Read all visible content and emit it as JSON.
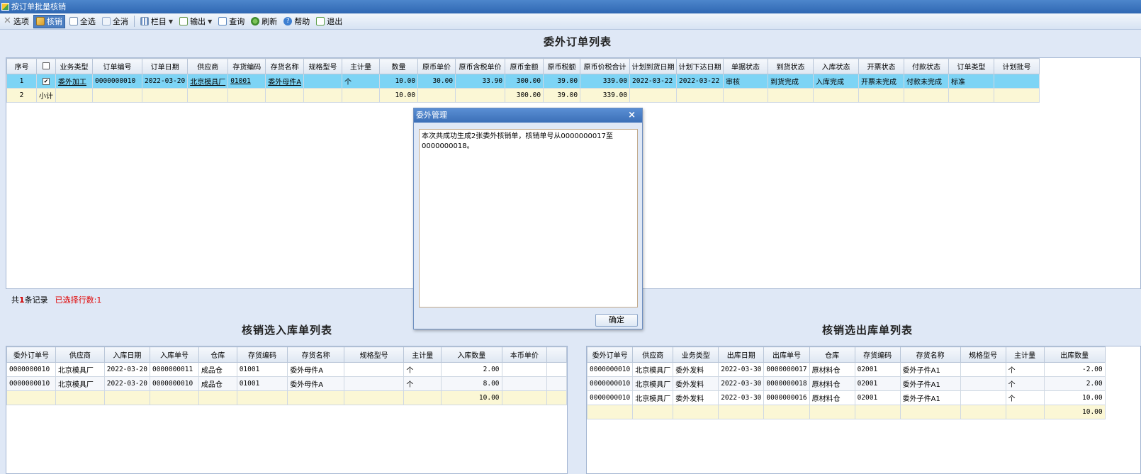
{
  "window": {
    "title": "按订单批量核销"
  },
  "toolbar": {
    "options": "选项",
    "writeoff": "核销",
    "select_all": "全选",
    "deselect_all": "全消",
    "columns": "栏目",
    "export": "输出",
    "query": "查询",
    "refresh": "刷新",
    "help": "帮助",
    "exit": "退出"
  },
  "orders": {
    "title": "委外订单列表",
    "headers": [
      "序号",
      "",
      "业务类型",
      "订单编号",
      "订单日期",
      "供应商",
      "存货编码",
      "存货名称",
      "规格型号",
      "主计量",
      "数量",
      "原币单价",
      "原币含税单价",
      "原币金额",
      "原币税额",
      "原币价税合计",
      "计划到货日期",
      "计划下达日期",
      "单据状态",
      "到货状态",
      "入库状态",
      "开票状态",
      "付款状态",
      "订单类型",
      "计划批号"
    ],
    "rows": [
      {
        "no": "1",
        "checked": "✔",
        "biz_type": "委外加工",
        "order_no": "0000000010",
        "order_date": "2022-03-20",
        "supplier": "北京模具厂",
        "inv_code": "01001",
        "inv_name": "委外母件A",
        "spec": "",
        "unit": "个",
        "qty": "10.00",
        "price": "30.00",
        "tax_price": "33.90",
        "amount": "300.00",
        "tax": "39.00",
        "total": "339.00",
        "plan_arrive": "2022-03-22",
        "plan_issue": "2022-03-22",
        "doc_status": "审核",
        "arrive_status": "到货完成",
        "instock_status": "入库完成",
        "invoice_status": "开票未完成",
        "pay_status": "付款未完成",
        "order_type": "标准",
        "batch": ""
      },
      {
        "no": "2",
        "label": "小计",
        "qty": "10.00",
        "amount": "300.00",
        "tax": "39.00",
        "total": "339.00"
      }
    ],
    "status_prefix": "共",
    "count": "1",
    "status_suffix": "条记录",
    "selected": "已选择行数:1"
  },
  "instock": {
    "title": "核销选入库单列表",
    "headers": [
      "委外订单号",
      "供应商",
      "入库日期",
      "入库单号",
      "仓库",
      "存货编码",
      "存货名称",
      "规格型号",
      "主计量",
      "入库数量",
      "本币单价",
      ""
    ],
    "rows": [
      [
        "0000000010",
        "北京模具厂",
        "2022-03-20",
        "0000000011",
        "成品仓",
        "01001",
        "委外母件A",
        "",
        "个",
        "2.00",
        ""
      ],
      [
        "0000000010",
        "北京模具厂",
        "2022-03-20",
        "0000000010",
        "成品仓",
        "01001",
        "委外母件A",
        "",
        "个",
        "8.00",
        ""
      ],
      [
        "",
        "",
        "",
        "",
        "",
        "",
        "",
        "",
        "",
        "10.00",
        ""
      ]
    ]
  },
  "outstock": {
    "title": "核销选出库单列表",
    "headers": [
      "委外订单号",
      "供应商",
      "业务类型",
      "出库日期",
      "出库单号",
      "仓库",
      "存货编码",
      "存货名称",
      "规格型号",
      "主计量",
      "出库数量"
    ],
    "rows": [
      [
        "0000000010",
        "北京模具厂",
        "委外发料",
        "2022-03-30",
        "0000000017",
        "原材料仓",
        "02001",
        "委外子件A1",
        "",
        "个",
        "-2.00"
      ],
      [
        "0000000010",
        "北京模具厂",
        "委外发料",
        "2022-03-30",
        "0000000018",
        "原材料仓",
        "02001",
        "委外子件A1",
        "",
        "个",
        "2.00"
      ],
      [
        "0000000010",
        "北京模具厂",
        "委外发料",
        "2022-03-30",
        "0000000016",
        "原材料仓",
        "02001",
        "委外子件A1",
        "",
        "个",
        "10.00"
      ],
      [
        "",
        "",
        "",
        "",
        "",
        "",
        "",
        "",
        "",
        "",
        "10.00"
      ]
    ]
  },
  "dialog": {
    "title": "委外管理",
    "close": "×",
    "message": "本次共成功生成2张委外核销单，核销单号从0000000017至0000000018。",
    "ok": "确定"
  }
}
